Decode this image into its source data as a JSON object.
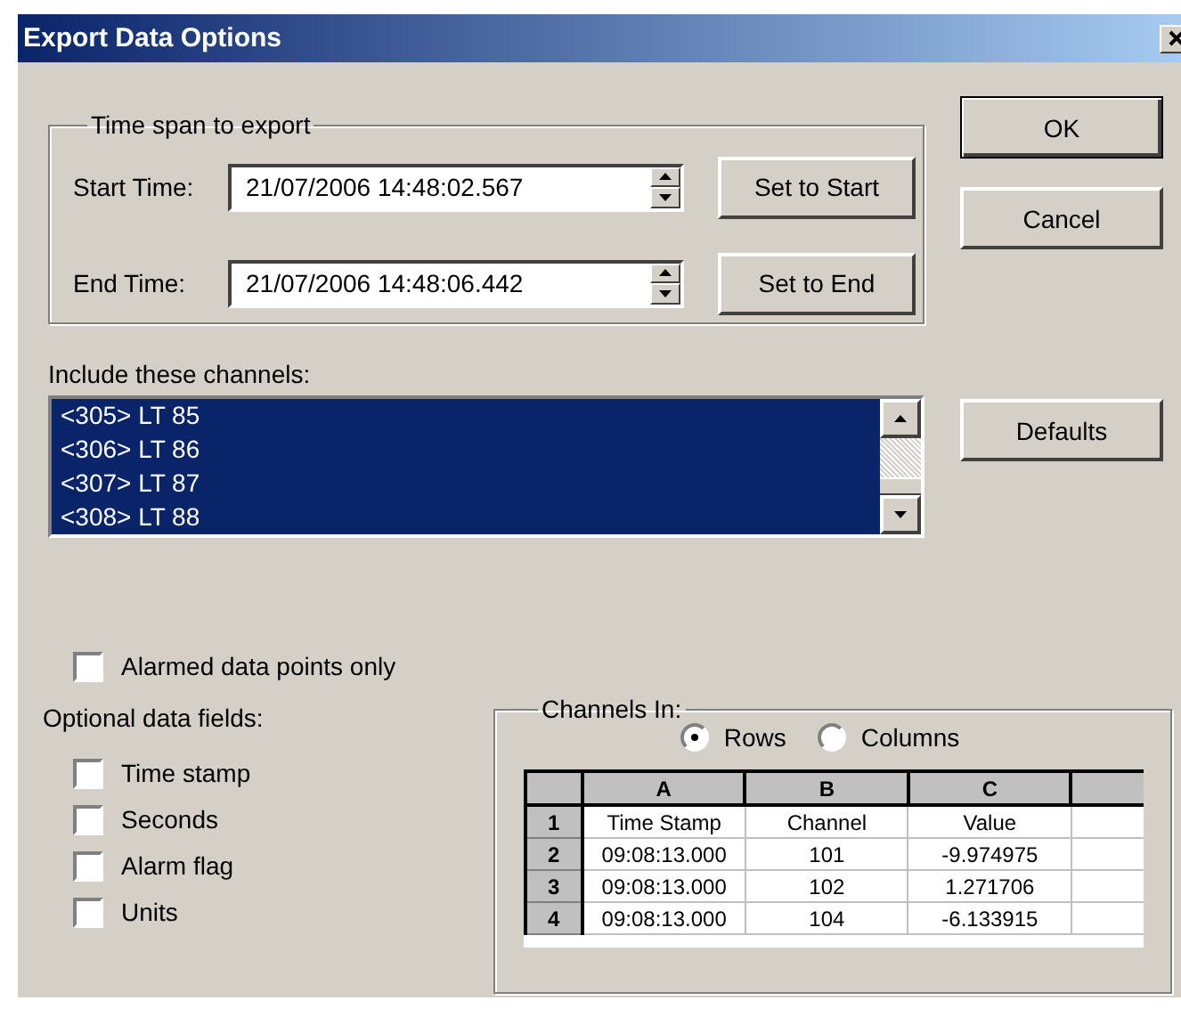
{
  "window": {
    "title": "Export Data Options"
  },
  "time_span": {
    "title": "Time span to export",
    "rows": [
      {
        "label": "Start Time:",
        "value": "21/07/2006 14:48:02.567",
        "button": "Set to Start"
      },
      {
        "label": "End Time:",
        "value": "21/07/2006 14:48:06.442",
        "button": "Set to End"
      }
    ]
  },
  "buttons": [
    {
      "label": "OK",
      "default": true
    },
    {
      "label": "Cancel",
      "default": false
    }
  ],
  "defaults_button": {
    "label": "Defaults"
  },
  "channels": {
    "label": "Include these channels:",
    "items": [
      {
        "label": "<305> LT 85",
        "selected": true
      },
      {
        "label": "<306> LT 86",
        "selected": true
      },
      {
        "label": "<307> LT 87",
        "selected": true
      },
      {
        "label": "<308> LT 88",
        "selected": true
      }
    ]
  },
  "alarmed_only": {
    "label": "Alarmed data points only",
    "checked": false
  },
  "optional_fields": {
    "label": "Optional data fields:",
    "items": [
      {
        "label": "Time stamp",
        "checked": false
      },
      {
        "label": "Seconds",
        "checked": false
      },
      {
        "label": "Alarm flag",
        "checked": false
      },
      {
        "label": "Units",
        "checked": false
      }
    ]
  },
  "channels_in": {
    "title": "Channels In:",
    "options": [
      {
        "label": "Rows",
        "selected": true
      },
      {
        "label": "Columns",
        "selected": false
      }
    ],
    "preview": {
      "columns": [
        "A",
        "B",
        "C"
      ],
      "rows": [
        {
          "header": "1",
          "cells": [
            "Time Stamp",
            "Channel",
            "Value"
          ]
        },
        {
          "header": "2",
          "cells": [
            "09:08:13.000",
            "101",
            "-9.974975"
          ]
        },
        {
          "header": "3",
          "cells": [
            "09:08:13.000",
            "102",
            "1.271706"
          ]
        },
        {
          "header": "4",
          "cells": [
            "09:08:13.000",
            "104",
            "-6.133915"
          ]
        }
      ]
    }
  }
}
